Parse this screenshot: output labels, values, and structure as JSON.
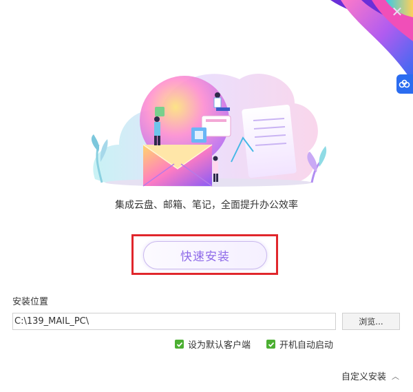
{
  "header": {
    "close_icon": "close-icon",
    "side_tab_icon": "cloud-icon"
  },
  "main": {
    "tagline": "集成云盘、邮箱、笔记，全面提升办公效率",
    "quick_install_label": "快速安装"
  },
  "install": {
    "location_label": "安装位置",
    "path_value": "C:\\139_MAIL_PC\\",
    "browse_label": "浏览..."
  },
  "options": {
    "default_client_label": "设为默认客户端",
    "default_client_checked": true,
    "autostart_label": "开机自动启动",
    "autostart_checked": true
  },
  "footer": {
    "custom_install_label": "自定义安装",
    "custom_install_icon": "chevron-up-icon"
  },
  "colors": {
    "accent_purple": "#8e6ae8",
    "highlight_red": "#e0262b",
    "checkbox_green": "#4caf32",
    "side_tab_blue": "#2b6cf0"
  }
}
